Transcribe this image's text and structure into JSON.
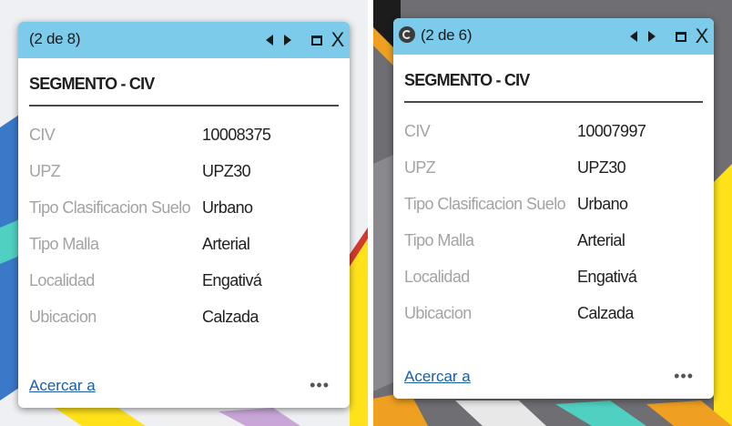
{
  "popups": [
    {
      "counter": "(2 de 8)",
      "title": "SEGMENTO - CIV",
      "fields": [
        {
          "label": "CIV",
          "value": "10008375"
        },
        {
          "label": "UPZ",
          "value": "UPZ30"
        },
        {
          "label": "Tipo Clasificacion Suelo",
          "value": "Urbano"
        },
        {
          "label": "Tipo Malla",
          "value": "Arterial"
        },
        {
          "label": "Localidad",
          "value": "Engativá"
        },
        {
          "label": "Ubicacion",
          "value": "Calzada"
        }
      ],
      "zoom_link": "Acercar a",
      "more": "•••"
    },
    {
      "counter": "(2 de 6)",
      "title": "SEGMENTO - CIV",
      "fields": [
        {
          "label": "CIV",
          "value": "10007997"
        },
        {
          "label": "UPZ",
          "value": "UPZ30"
        },
        {
          "label": "Tipo Clasificacion Suelo",
          "value": "Urbano"
        },
        {
          "label": "Tipo Malla",
          "value": "Arterial"
        },
        {
          "label": "Localidad",
          "value": "Engativá"
        },
        {
          "label": "Ubicacion",
          "value": "Calzada"
        }
      ],
      "zoom_link": "Acercar a",
      "more": "•••"
    }
  ],
  "icons": {
    "previous": "triangle-left-icon",
    "next": "triangle-right-icon",
    "maximize": "square-icon",
    "close": "x-icon",
    "loading": "spinner-icon"
  },
  "close_glyph": "X",
  "colors": {
    "titlebar": "#7ccbeb",
    "link": "#1a5ea6",
    "label": "#a3a3a3"
  }
}
